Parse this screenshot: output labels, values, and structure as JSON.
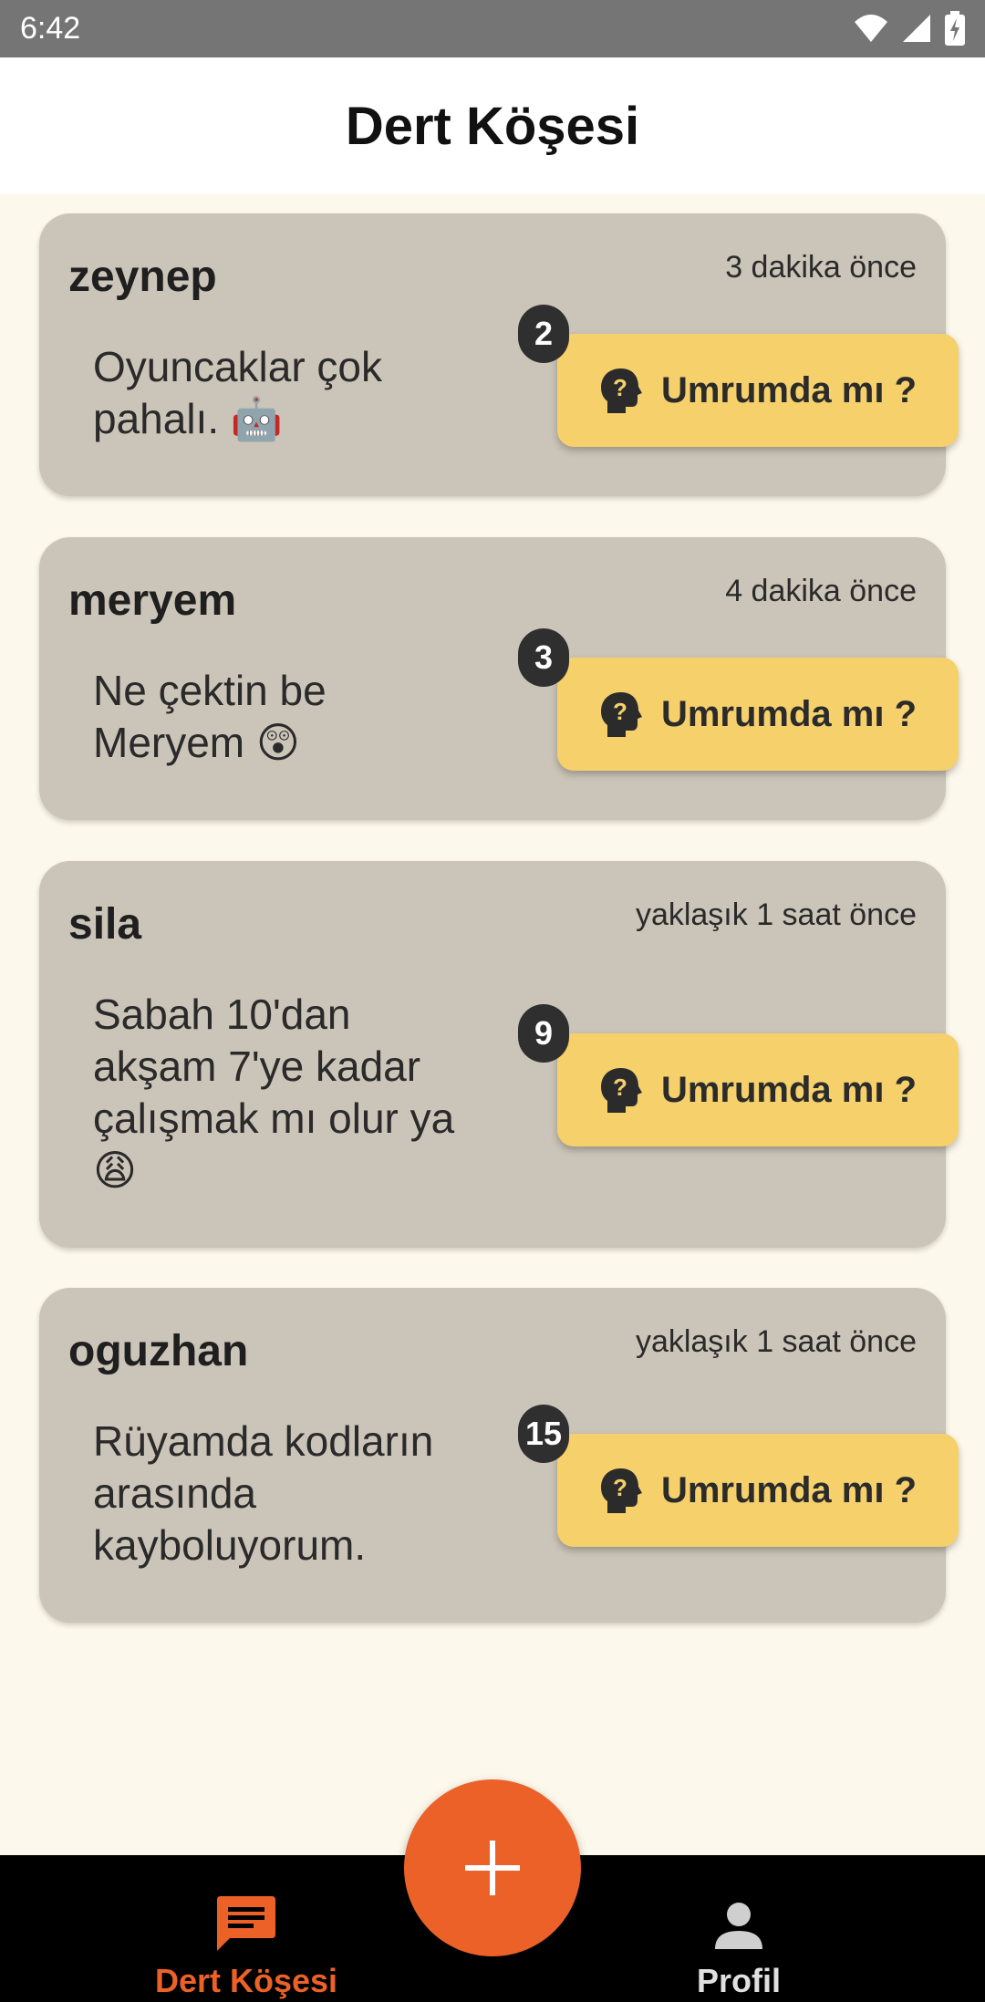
{
  "status_bar": {
    "time": "6:42"
  },
  "app_bar": {
    "title": "Dert Köşesi"
  },
  "posts": [
    {
      "user": "zeynep",
      "time": "3 dakika önce",
      "text": "Oyuncaklar çok pahalı. 🤖",
      "count": "2",
      "button": "Umrumda mı ?"
    },
    {
      "user": "meryem",
      "time": "4 dakika önce",
      "text": "Ne çektin be Meryem 😲",
      "count": "3",
      "button": "Umrumda mı ?"
    },
    {
      "user": "sila",
      "time": "yaklaşık 1 saat önce",
      "text": "Sabah 10'dan akşam 7'ye kadar çalışmak mı olur ya 😩",
      "count": "9",
      "button": "Umrumda mı ?"
    },
    {
      "user": "oguzhan",
      "time": "yaklaşık 1 saat önce",
      "text": "Rüyamda kodların arasında kayboluyorum.",
      "count": "15",
      "button": "Umrumda mı ?"
    }
  ],
  "bottom_nav": {
    "items": [
      {
        "label": "Dert Köşesi",
        "icon": "chat-icon",
        "active": true
      },
      {
        "label": "Profil",
        "icon": "person-icon",
        "active": false
      }
    ]
  },
  "fab": {
    "icon": "plus-icon"
  },
  "colors": {
    "accent": "#ec6127",
    "card": "#cbc4b8",
    "button": "#f5d06b",
    "background": "#fdf8ec"
  }
}
